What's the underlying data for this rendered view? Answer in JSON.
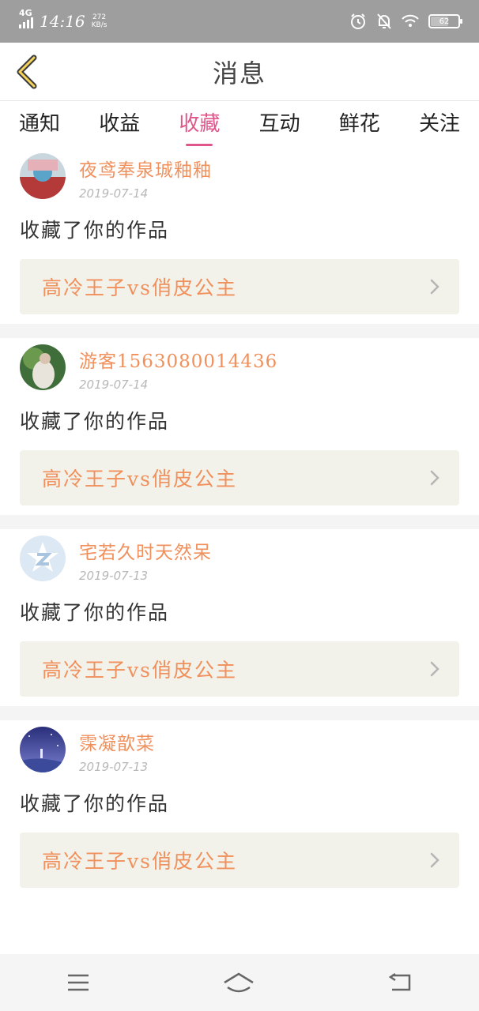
{
  "status_bar": {
    "network": "4G",
    "time": "14:16",
    "speed_value": "272",
    "speed_unit": "KB/s",
    "battery": "62"
  },
  "header": {
    "title": "消息"
  },
  "tabs": [
    {
      "label": "通知",
      "active": false
    },
    {
      "label": "收益",
      "active": false
    },
    {
      "label": "收藏",
      "active": true
    },
    {
      "label": "互动",
      "active": false
    },
    {
      "label": "鲜花",
      "active": false
    },
    {
      "label": "关注",
      "active": false
    }
  ],
  "messages": [
    {
      "username": "夜鸢奉泉珹釉釉",
      "date": "2019-07-14",
      "action": "收藏了你的作品",
      "work_title": "高冷王子vs俏皮公主",
      "avatar": "avatar-1"
    },
    {
      "username": "游客1563080014436",
      "date": "2019-07-14",
      "action": "收藏了你的作品",
      "work_title": "高冷王子vs俏皮公主",
      "avatar": "avatar-2"
    },
    {
      "username": "宅若久时天然呆",
      "date": "2019-07-13",
      "action": "收藏了你的作品",
      "work_title": "高冷王子vs俏皮公主",
      "avatar": "avatar-qq-default"
    },
    {
      "username": "霂凝歆菜",
      "date": "2019-07-13",
      "action": "收藏了你的作品",
      "work_title": "高冷王子vs俏皮公主",
      "avatar": "avatar-4"
    }
  ],
  "icons": {
    "back": "chevron-left-icon",
    "item_arrow": "chevron-right-icon",
    "nav_menu": "menu-icon",
    "nav_home": "home-icon",
    "nav_back": "return-icon"
  },
  "colors": {
    "accent": "#e0568a",
    "username": "#f0905c",
    "status_bar": "#9e9e9e",
    "work_box": "#f3f2ea"
  }
}
